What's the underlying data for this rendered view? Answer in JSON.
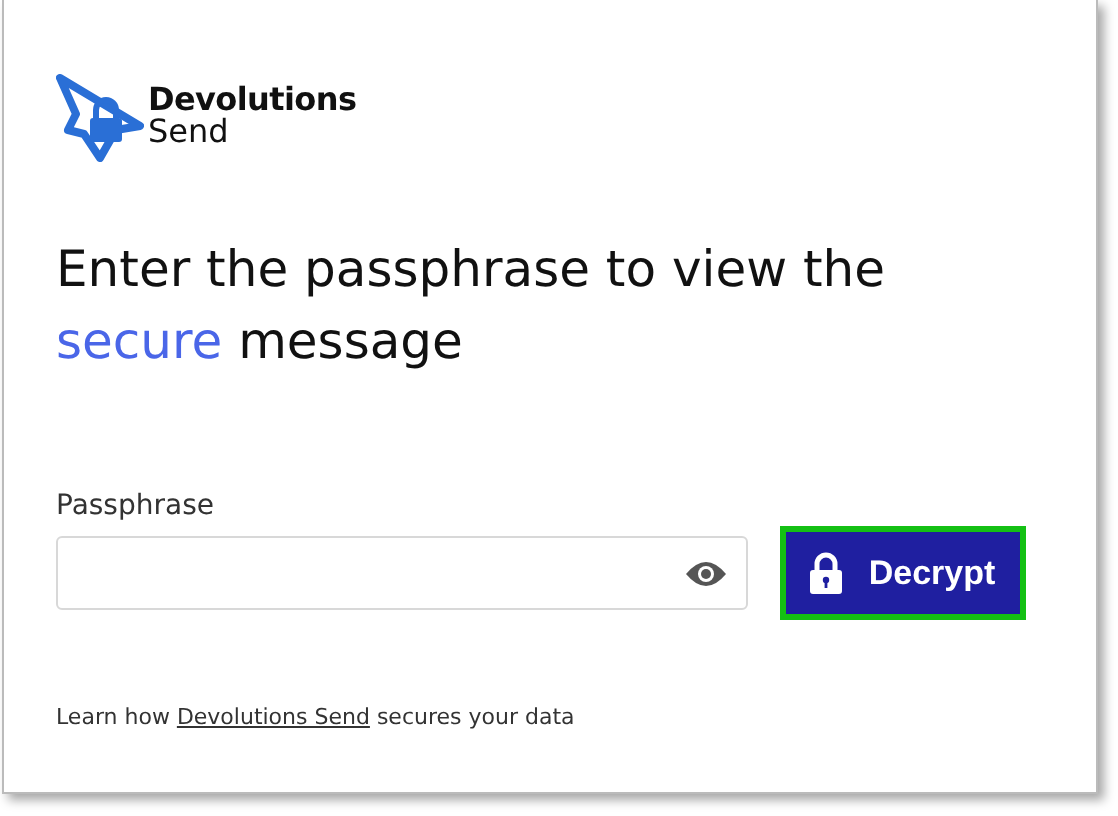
{
  "logo": {
    "line_1": "Devolutions",
    "line_2": "Send"
  },
  "heading": [
    {
      "text": "Enter the passphrase to view the",
      "highlight": false
    },
    {
      "text": "secure",
      "highlight": true
    },
    {
      "text": "message",
      "highlight": false
    }
  ],
  "passphrase": {
    "label": "Passphrase"
  },
  "decrypt_button": {
    "label": "Decrypt",
    "focused": true
  },
  "footer": {
    "before": "Learn how",
    "link": "Devolutions Send",
    "after": "secures your data"
  }
}
